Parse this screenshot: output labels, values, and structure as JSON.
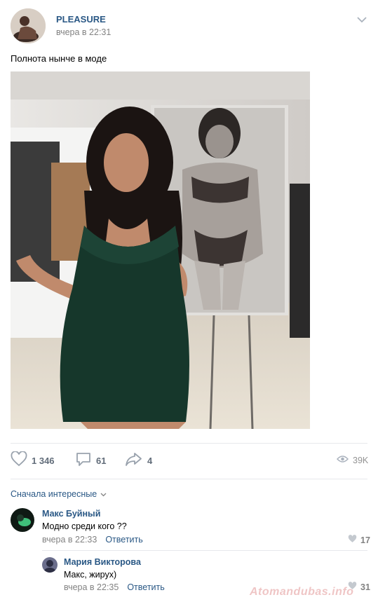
{
  "post": {
    "author": "PLEASURE",
    "time": "вчера в 22:31",
    "text": "Полнота нынче в моде"
  },
  "actions": {
    "likes": "1 346",
    "comments": "61",
    "shares": "4",
    "views": "39K"
  },
  "comments_section": {
    "sort_label": "Сначала интересные",
    "comments": [
      {
        "author": "Макс Буйный",
        "text": "Модно среди кого ??",
        "time": "вчера в 22:33",
        "reply_label": "Ответить",
        "likes": "17"
      },
      {
        "author": "Мария Викторова",
        "text": "Макс, жирух)",
        "time": "вчера в 22:35",
        "reply_label": "Ответить",
        "likes": "31"
      }
    ]
  },
  "watermark": "Atomandubas.info",
  "colors": {
    "link": "#2a5885",
    "muted": "#828282",
    "icon": "#99a2ad",
    "divider": "#e7e8ec"
  },
  "icons": [
    "chevron-down-icon",
    "heart-icon",
    "comment-icon",
    "share-icon",
    "eye-icon"
  ]
}
